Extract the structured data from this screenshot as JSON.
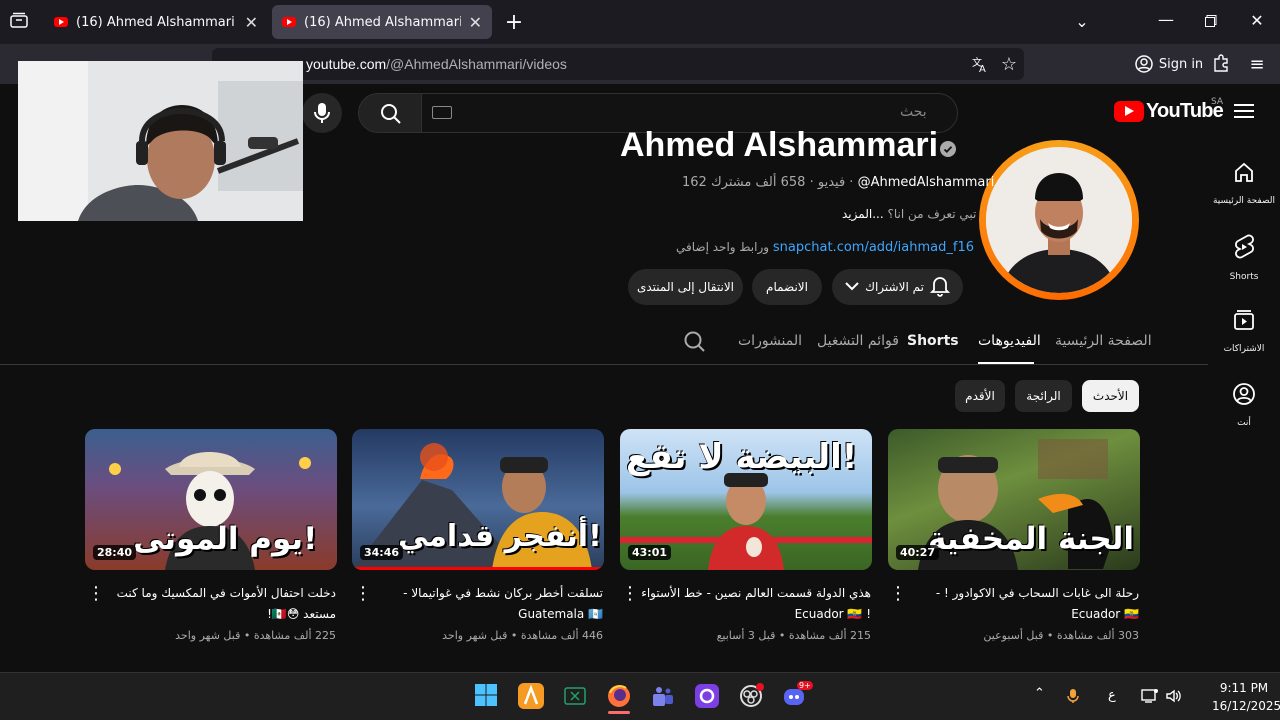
{
  "browser": {
    "tabs": [
      {
        "title": "(16) Ahmed Alshammari - YouTu",
        "active": false
      },
      {
        "title": "(16) Ahmed Alshammari - YouTu",
        "active": true
      }
    ],
    "url_domain": "youtube.com",
    "url_path": "/@AhmedAlshammari/videos",
    "sign_in": "Sign in"
  },
  "youtube": {
    "logo": "YouTube",
    "country": "SA",
    "search_placeholder": "بحث"
  },
  "sidebar": {
    "items": [
      {
        "label": "الصفحة الرئيسية",
        "icon": "home-icon"
      },
      {
        "label": "Shorts",
        "icon": "shorts-icon"
      },
      {
        "label": "الاشتراكات",
        "icon": "subscriptions-icon"
      },
      {
        "label": "أنت",
        "icon": "you-icon"
      }
    ]
  },
  "channel": {
    "name": "Ahmed Alshammari",
    "handle": "@AhmedAlshammari",
    "subscribers": "658 ألف مشترك",
    "videos_count": "162 فيديو",
    "description": "تبي تعرف من انا؟",
    "more": "...المزيد",
    "link": "snapchat.com/add/iahmad_f16",
    "link_suffix": "ورابط واحد إضافي",
    "subscribed_label": "تم الاشتراك",
    "join_label": "الانضمام",
    "community_label": "الانتقال إلى المنتدى"
  },
  "tabs": [
    "الصفحة الرئيسية",
    "الفيديوهات",
    "Shorts",
    "قوائم التشغيل",
    "المنشورات"
  ],
  "chips": [
    "الأحدث",
    "الرائجة",
    "الأقدم"
  ],
  "videos": [
    {
      "thumb_text": "الجنة المخفية",
      "duration": "40:27",
      "title": "رحلة الى غابات السحاب في الاكوادور ! - Ecuador 🇪🇨",
      "views": "303 ألف مشاهدة",
      "age": "قبل أسبوعين"
    },
    {
      "thumb_text": "البيضة لا تقع!",
      "duration": "43:01",
      "title": "هذي الدولة قسمت العالم نصين - خط الأستواء ! Ecuador 🇪🇨",
      "views": "215 ألف مشاهدة",
      "age": "قبل 3 أسابيع"
    },
    {
      "thumb_text": "أنفجر قدامي!",
      "duration": "34:46",
      "title": "تسلقت أخطر بركان نشط في غواتيمالا - Guatemala 🇬🇹",
      "views": "446 ألف مشاهدة",
      "age": "قبل شهر واحد"
    },
    {
      "thumb_text": "يوم الموتى!",
      "duration": "28:40",
      "title": "دخلت احتفال الأموات في المكسيك وما كنت مستعد 😳🇲🇽!",
      "views": "225 ألف مشاهدة",
      "age": "قبل شهر واحد"
    }
  ],
  "taskbar": {
    "time": "9:11 PM",
    "date": "16/12/2025",
    "lang": "ع",
    "discord_badge": "9+"
  }
}
